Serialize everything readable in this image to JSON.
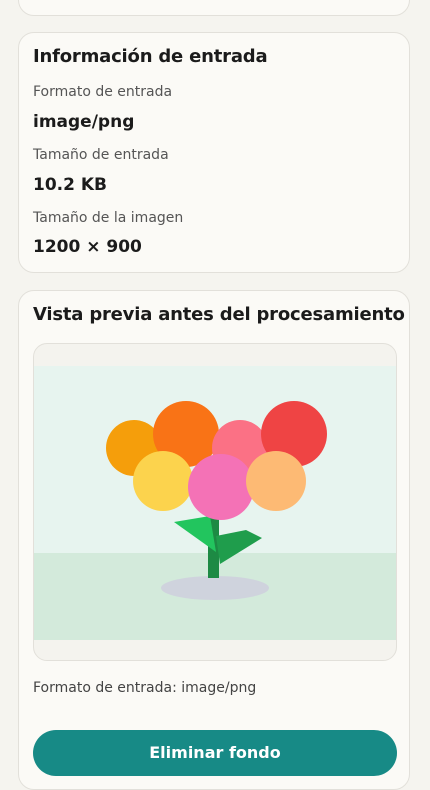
{
  "info_card": {
    "title": "Información de entrada",
    "fields": [
      {
        "label": "Formato de entrada",
        "value": "image/png"
      },
      {
        "label": "Tamaño de entrada",
        "value": "10.2 KB"
      },
      {
        "label": "Tamaño de la imagen",
        "value": "1200 × 900"
      }
    ]
  },
  "preview_card": {
    "title": "Vista previa antes del procesamiento",
    "caption": "Formato de entrada: image/png",
    "button_label": "Eliminar fondo"
  },
  "colors": {
    "accent": "#178a86",
    "card_background": "#fbfaf6",
    "page_background": "#f5f4ef"
  }
}
